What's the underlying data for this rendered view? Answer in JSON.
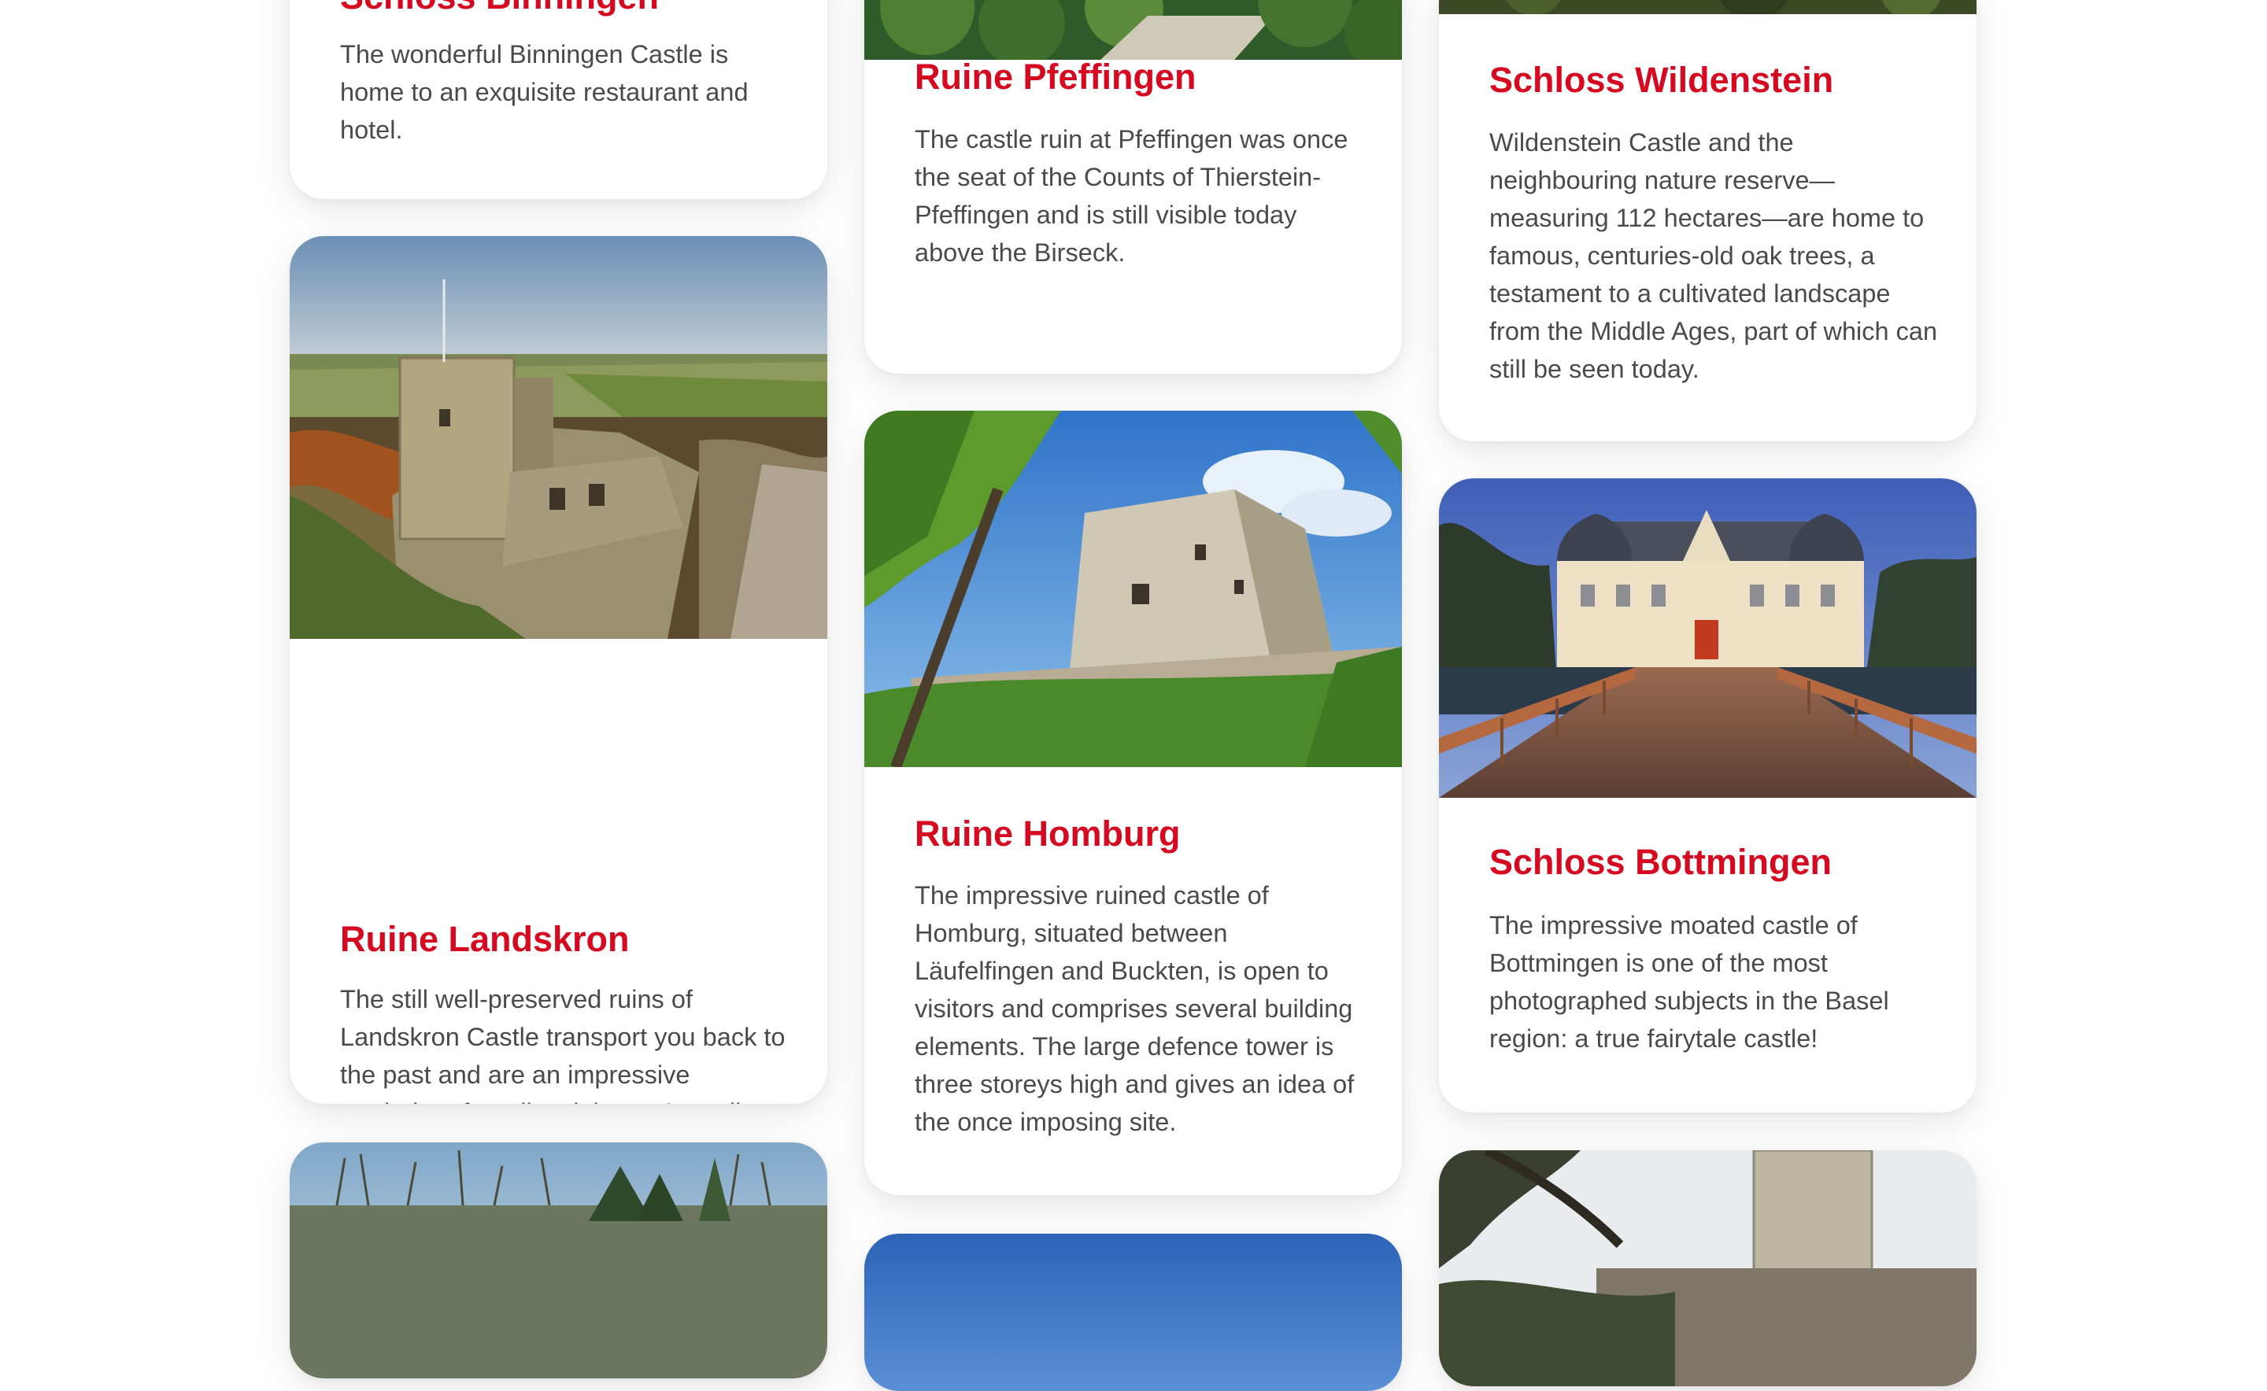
{
  "cards": {
    "binningen": {
      "title": "Schloss Binningen",
      "text": "The wonderful Binningen Castle is home to an exquisite restaurant and hotel."
    },
    "landskron": {
      "title": "Ruine Landskron",
      "text": "The still well-preserved ruins of Landskron Castle transport you back to the past and are an impressive reminder of medieval times. As well as the wonderful castle complex itself—which lies in French territory in the commune of Leymen—it is worth visiting for the amazing views."
    },
    "pfeffingen": {
      "title": "Ruine Pfeffingen",
      "text": "The castle ruin at Pfeffingen was once the seat of the Counts of Thierstein-Pfeffingen and is still visible today above the Birseck."
    },
    "homburg": {
      "title": "Ruine Homburg",
      "text": "The impressive ruined castle of Homburg, situated between Läufelfingen and Buckten, is open to visitors and comprises several building elements. The large defence tower is three storeys high and gives an idea of the once imposing site."
    },
    "wildenstein": {
      "title": "Schloss Wildenstein",
      "text": "Wildenstein Castle and the neighbouring nature reserve—measuring 112 hectares—are home to famous, centuries-old oak trees, a testament to a cultivated landscape from the Middle Ages, part of which can still be seen today."
    },
    "bottmingen": {
      "title": "Schloss Bottmingen",
      "text": "The impressive moated castle of Bottmingen is one of the most photographed subjects in the Basel region: a true fairytale castle!"
    }
  },
  "colors": {
    "title": "#d50a20",
    "body_text": "#4a4a4a",
    "card_bg": "#ffffff",
    "page_bg": "#ffffff"
  }
}
